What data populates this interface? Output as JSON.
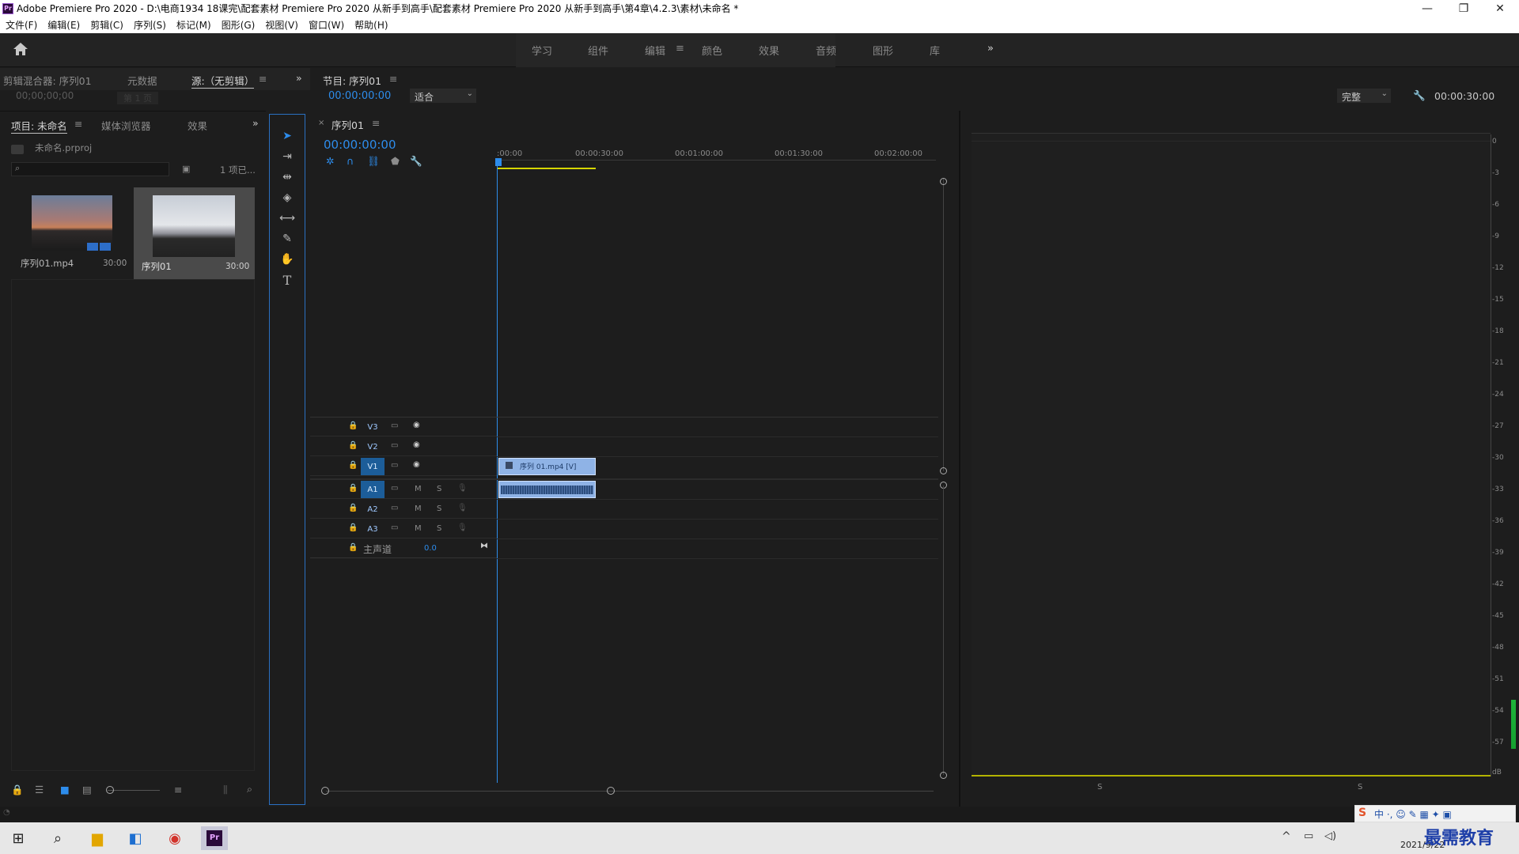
{
  "title_bar": {
    "app_badge": "Pr",
    "title": "Adobe Premiere Pro 2020 - D:\\电商1934 18课完\\配套素材 Premiere Pro 2020 从新手到高手\\配套素材 Premiere Pro 2020 从新手到高手\\第4章\\4.2.3\\素材\\未命名 *",
    "minimize": "—",
    "restore": "❐",
    "close": "✕"
  },
  "menu": [
    "文件(F)",
    "编辑(E)",
    "剪辑(C)",
    "序列(S)",
    "标记(M)",
    "图形(G)",
    "视图(V)",
    "窗口(W)",
    "帮助(H)"
  ],
  "workspaces": {
    "items": [
      "学习",
      "组件",
      "编辑",
      "颜色",
      "效果",
      "音频",
      "图形",
      "库"
    ],
    "active": "编辑",
    "more": "»"
  },
  "source_panel": {
    "tabs": [
      "剪辑混合器: 序列01",
      "元数据",
      "源:（无剪辑）"
    ],
    "timecode": "00;00;00;00",
    "page": "第 1 页",
    "more": "»"
  },
  "program_panel": {
    "tab": "节目: 序列01",
    "timecode": "00:00:00:00",
    "fit": "适合",
    "quality": "完整",
    "duration": "00:00:30:00"
  },
  "project_panel": {
    "tabs": [
      "项目: 未命名",
      "媒体浏览器",
      "效果"
    ],
    "file": "未命名.prproj",
    "search_placeholder": "",
    "items_count": "1 项已...",
    "items": [
      {
        "name": "序列01.mp4",
        "duration": "30:00"
      },
      {
        "name": "序列01",
        "duration": "30:00"
      }
    ]
  },
  "timeline": {
    "tab": "序列01",
    "timecode": "00:00:00:00",
    "ruler": [
      ":00:00",
      "00:00:30:00",
      "00:01:00:00",
      "00:01:30:00",
      "00:02:00:00"
    ],
    "tracks": [
      {
        "label": "V3",
        "type": "video"
      },
      {
        "label": "V2",
        "type": "video"
      },
      {
        "label": "V1",
        "type": "video"
      },
      {
        "label": "A1",
        "type": "audio",
        "m": "M",
        "s": "S"
      },
      {
        "label": "A2",
        "type": "audio",
        "m": "M",
        "s": "S"
      },
      {
        "label": "A3",
        "type": "audio",
        "m": "M",
        "s": "S"
      }
    ],
    "master": {
      "label": "主声道",
      "value": "0.0"
    },
    "clip_video": "序列 01.mp4 [V]"
  },
  "audio_meter": {
    "scale": [
      "0",
      "-3",
      "-6",
      "-9",
      "-12",
      "-15",
      "-18",
      "-21",
      "-24",
      "-27",
      "-30",
      "-33",
      "-36",
      "-39",
      "-42",
      "-45",
      "-48",
      "-51",
      "-54",
      "-57",
      "dB"
    ],
    "solo_left": "S",
    "solo_right": "S"
  },
  "taskbar": {
    "date": "2021/9/22",
    "watermark": "最需教育"
  },
  "colors": {
    "accent_blue": "#2d8ceb",
    "track_on": "#1c5d99",
    "clip": "#8fb3e6",
    "playhead": "#2d8ceb",
    "work_area": "#d6d600"
  }
}
